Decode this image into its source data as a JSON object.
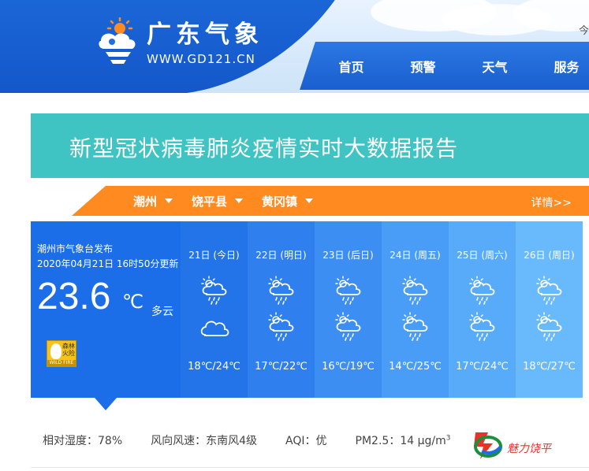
{
  "header": {
    "brand_name": "广东气象",
    "brand_url": "WWW.GD121.CN",
    "top_link": "今",
    "nav": [
      "首页",
      "预警",
      "天气",
      "服务"
    ]
  },
  "banner": {
    "title": "新型冠状病毒肺炎疫情实时大数据报告"
  },
  "location": {
    "city": "潮州",
    "county": "饶平县",
    "town": "黄冈镇",
    "detail": "详情>>"
  },
  "current": {
    "source": "潮州市气象台发布",
    "updated": "2020年04月21日 16时50分更新",
    "temperature": "23.6",
    "unit": "℃",
    "condition": "多云",
    "warning_icon": "forest-fire-warning-icon",
    "warning_text": "森林火险",
    "warning_sub": "WILD FIRE"
  },
  "forecast": [
    {
      "label": "21日 (今日)",
      "range": "18℃/24℃",
      "icon_day": "partly-cloudy-rain",
      "icon_night": "cloudy",
      "bg": "#2474e9"
    },
    {
      "label": "22日 (明日)",
      "range": "17℃/22℃",
      "icon_day": "partly-cloudy-rain",
      "icon_night": "partly-cloudy-rain",
      "bg": "#2f80ee"
    },
    {
      "label": "23日 (后日)",
      "range": "16℃/19℃",
      "icon_day": "partly-cloudy-rain",
      "icon_night": "partly-cloudy-rain",
      "bg": "#3d8ef3"
    },
    {
      "label": "24日 (周五)",
      "range": "14℃/25℃",
      "icon_day": "partly-cloudy-rain",
      "icon_night": "partly-cloudy-rain",
      "bg": "#4a9df6"
    },
    {
      "label": "25日 (周六)",
      "range": "17℃/24℃",
      "icon_day": "partly-cloudy-rain",
      "icon_night": "partly-cloudy-rain",
      "bg": "#58abf9"
    },
    {
      "label": "26日 (周日)",
      "range": "18℃/27℃",
      "icon_day": "partly-cloudy-rain",
      "icon_night": "partly-cloudy-rain",
      "bg": "#69bafc"
    }
  ],
  "stats": {
    "humidity": "相对湿度：78%",
    "wind": "风向风速：东南风4级",
    "aqi": "AQI：优",
    "pm25": "PM2.5：14 μg/m",
    "pm25_sup": "3"
  },
  "promo": {
    "text": "魅力饶平"
  },
  "colors": {
    "brand_blue": "#1b6ee8",
    "teal": "#3fc3c3",
    "orange": "#ff8a1f"
  }
}
